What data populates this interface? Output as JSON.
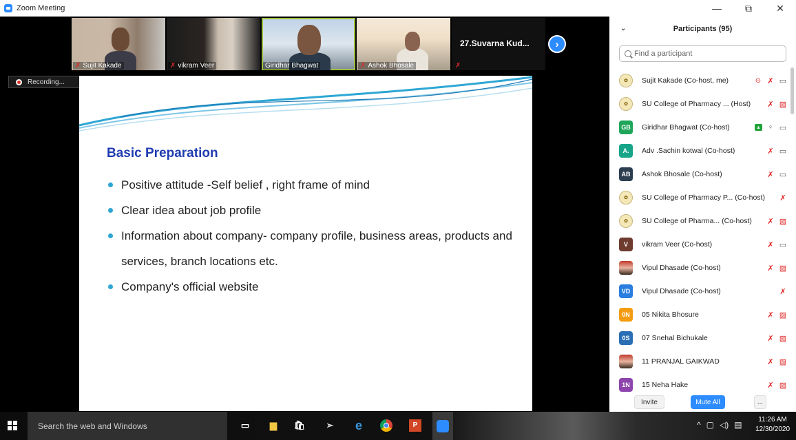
{
  "window": {
    "title": "Zoom Meeting",
    "controls": {
      "minimize": "—",
      "restore": "⧉",
      "close": "✕"
    }
  },
  "thumbnails": [
    {
      "name": "Sujit Kakade",
      "muted": true
    },
    {
      "name": "vikram Veer",
      "muted": true
    },
    {
      "name": "Giridhar Bhagwat",
      "muted": false,
      "active": true
    },
    {
      "name": "Ashok Bhosale",
      "muted": true
    },
    {
      "name": "27.Suvarna  Kud...",
      "muted": true
    }
  ],
  "recording": {
    "label": "Recording..."
  },
  "slide": {
    "heading": "Basic Preparation",
    "bullets": [
      "Positive attitude -Self belief , right frame of mind",
      "Clear idea about job profile",
      "Information about company- company profile, business areas, products and services, branch locations etc.",
      "Company's official website"
    ]
  },
  "participants": {
    "title": "Participants (95)",
    "search_placeholder": "Find a participant",
    "list": [
      {
        "initials": "",
        "avatar": "logo",
        "color": "#f4e7b8",
        "name": "Sujit Kakade (Co-host, me)",
        "rec": true,
        "share": false,
        "mic": "muted",
        "cam": "on"
      },
      {
        "initials": "",
        "avatar": "logo",
        "color": "#f4e7b8",
        "name": "SU College of Pharmacy ... (Host)",
        "rec": false,
        "share": false,
        "mic": "muted",
        "cam": "off"
      },
      {
        "initials": "GB",
        "avatar": "initials",
        "color": "#1fa65a",
        "name": "Giridhar Bhagwat (Co-host)",
        "rec": false,
        "share": true,
        "mic": "on",
        "cam": "on"
      },
      {
        "initials": "A.",
        "avatar": "initials",
        "color": "#17a589",
        "name": "Adv .Sachin kotwal (Co-host)",
        "rec": false,
        "share": false,
        "mic": "muted",
        "cam": "on"
      },
      {
        "initials": "AB",
        "avatar": "initials",
        "color": "#2c3e50",
        "name": "Ashok Bhosale (Co-host)",
        "rec": false,
        "share": false,
        "mic": "muted",
        "cam": "on"
      },
      {
        "initials": "",
        "avatar": "logo",
        "color": "#f4e7b8",
        "name": "SU College of Pharmacy P... (Co-host)",
        "rec": false,
        "share": false,
        "mic": "muted",
        "cam": "none"
      },
      {
        "initials": "",
        "avatar": "logo",
        "color": "#f4e7b8",
        "name": "SU College of Pharma... (Co-host)",
        "rec": false,
        "share": false,
        "mic": "muted",
        "cam": "off"
      },
      {
        "initials": "V",
        "avatar": "initials",
        "color": "#6e3b2f",
        "name": "vikram Veer (Co-host)",
        "rec": false,
        "share": false,
        "mic": "muted",
        "cam": "on"
      },
      {
        "initials": "",
        "avatar": "photo",
        "color": "#c0392b",
        "name": "Vipul Dhasade (Co-host)",
        "rec": false,
        "share": false,
        "mic": "muted",
        "cam": "off"
      },
      {
        "initials": "VD",
        "avatar": "initials",
        "color": "#2a7ee0",
        "name": "Vipul Dhasade (Co-host)",
        "rec": false,
        "share": false,
        "mic": "muted",
        "cam": "none"
      },
      {
        "initials": "0N",
        "avatar": "initials",
        "color": "#f39c12",
        "name": "05 Nikita Bhosure",
        "rec": false,
        "share": false,
        "mic": "muted",
        "cam": "off"
      },
      {
        "initials": "0S",
        "avatar": "initials",
        "color": "#2a6fb5",
        "name": "07 Snehal Bichukale",
        "rec": false,
        "share": false,
        "mic": "muted",
        "cam": "off"
      },
      {
        "initials": "",
        "avatar": "photo",
        "color": "#3b2a20",
        "name": "11 PRANJAL GAIKWAD",
        "rec": false,
        "share": false,
        "mic": "muted",
        "cam": "off"
      },
      {
        "initials": "1N",
        "avatar": "initials",
        "color": "#8e44ad",
        "name": "15 Neha Hake",
        "rec": false,
        "share": false,
        "mic": "muted",
        "cam": "off"
      }
    ],
    "buttons": {
      "invite": "Invite",
      "mute_all": "Mute All",
      "more": "..."
    }
  },
  "taskbar": {
    "search_placeholder": "Search the web and Windows",
    "time": "11:26 AM",
    "date": "12/30/2020"
  },
  "colors": {
    "zoom_blue": "#2D8CFF",
    "muted_red": "#e02828",
    "slide_heading": "#1f3bb0",
    "bullet": "#2ea6d4"
  }
}
